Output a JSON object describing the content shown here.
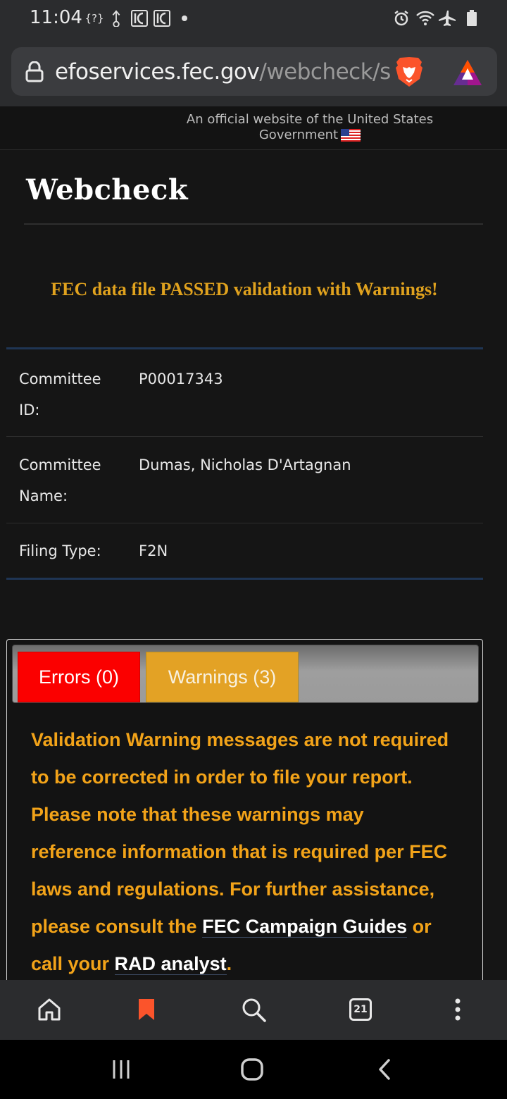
{
  "status_bar": {
    "time": "11:04",
    "notification_icons": [
      "unknown-notification-icon",
      "usb-icon",
      "app-icon",
      "app-icon",
      "dot-icon"
    ],
    "system_icons": [
      "alarm-icon",
      "wifi-icon",
      "airplane-mode-icon",
      "battery-icon"
    ]
  },
  "browser": {
    "url_domain": "efoservices.fec.gov",
    "url_path": "/webcheck/se",
    "bottom_toolbar": {
      "tab_count": "21",
      "icons": [
        "home-icon",
        "bookmark-icon",
        "search-icon",
        "tabs-icon",
        "more-menu-icon"
      ]
    }
  },
  "gov_banner": {
    "text": "An official website of the United States Government"
  },
  "page": {
    "title": "Webcheck",
    "result_message": "FEC data file PASSED validation with Warnings!",
    "info_rows": [
      {
        "label": "Committee ID:",
        "value": "P00017343"
      },
      {
        "label": "Committee Name:",
        "value": "Dumas, Nicholas D'Artagnan"
      },
      {
        "label": "Filing Type:",
        "value": "F2N"
      }
    ],
    "tabs": {
      "errors": "Errors (0)",
      "warnings": "Warnings (3)"
    },
    "warning_message": {
      "part1": "Validation Warning messages are not required to be corrected in order to file your report. Please note that these warnings may reference information that is required per FEC laws and regulations. For further assistance, please consult the ",
      "link1": "FEC Campaign Guides",
      "part2": " or call your ",
      "link2": "RAD analyst",
      "part3": "."
    }
  },
  "colors": {
    "accent_orange": "#f2a319",
    "errors_tab": "#fb0000",
    "warnings_tab": "#e3a225",
    "brave_orange": "#fb542b"
  },
  "android_nav": {
    "icons": [
      "recent-apps-icon",
      "home-button-icon",
      "back-icon"
    ]
  }
}
